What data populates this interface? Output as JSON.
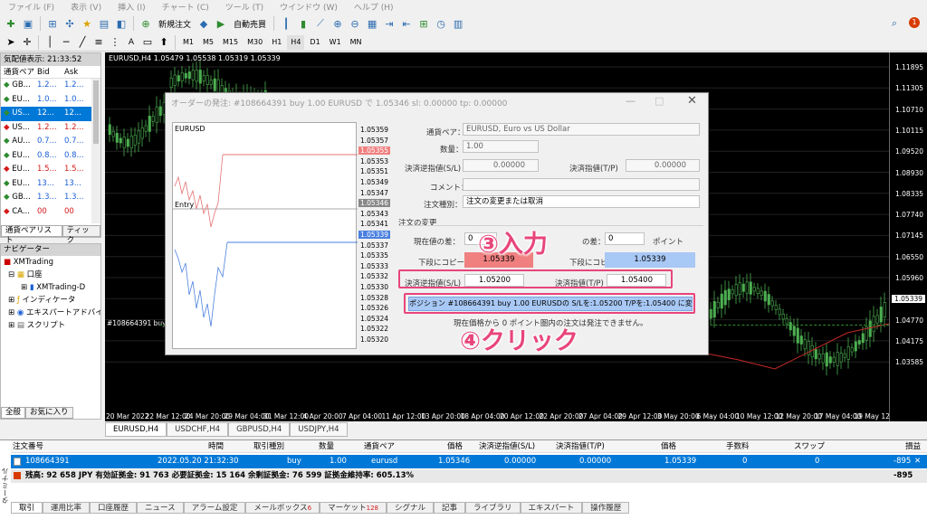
{
  "menu": [
    "ファイル (F)",
    "表示 (V)",
    "挿入 (I)",
    "チャート (C)",
    "ツール (T)",
    "ウインドウ (W)",
    "ヘルプ (H)"
  ],
  "toolbar": {
    "new_order": "新規注文",
    "auto_trade": "自動売買",
    "notif_count": "1"
  },
  "timeframes": [
    "M1",
    "M5",
    "M15",
    "M30",
    "H1",
    "H4",
    "D1",
    "W1",
    "MN"
  ],
  "market": {
    "title": "気配値表示: 21:33:52",
    "cols": [
      "通貨ペア",
      "Bid",
      "Ask"
    ],
    "rows": [
      {
        "s": "GB...",
        "b": "1.2...",
        "a": "1.2...",
        "dir": "up"
      },
      {
        "s": "EU...",
        "b": "1.0...",
        "a": "1.0...",
        "dir": "up"
      },
      {
        "s": "US...",
        "b": "12...",
        "a": "12...",
        "dir": "up",
        "sel": true
      },
      {
        "s": "US...",
        "b": "1.2...",
        "a": "1.2...",
        "dir": "dn"
      },
      {
        "s": "AU...",
        "b": "0.7...",
        "a": "0.7...",
        "dir": "up"
      },
      {
        "s": "EU...",
        "b": "0.8...",
        "a": "0.8...",
        "dir": "up"
      },
      {
        "s": "EU...",
        "b": "1.5...",
        "a": "1.5...",
        "dir": "dn"
      },
      {
        "s": "EU...",
        "b": "13...",
        "a": "13...",
        "dir": "up"
      },
      {
        "s": "GB...",
        "b": "1.3...",
        "a": "1.3...",
        "dir": "up"
      },
      {
        "s": "CA...",
        "b": "00",
        "a": "00",
        "dir": "dn"
      }
    ],
    "tabs": [
      "通貨ペアリスト",
      "ティック"
    ]
  },
  "navigator": {
    "title": "ナビゲーター",
    "items": [
      "XMTrading",
      "口座",
      "XMTrading-D",
      "インディケータ",
      "エキスパートアドバイザ",
      "スクリプト"
    ],
    "tabs": [
      "全般",
      "お気に入り"
    ]
  },
  "chart": {
    "title": "EURUSD,H4  1.05479 1.05538 1.05319 1.05339",
    "order_line": "#108664391 buy 1.00",
    "prices": [
      "1.11895",
      "1.11305",
      "1.10710",
      "1.10115",
      "1.09520",
      "1.08930",
      "1.08335",
      "1.07740",
      "1.07145",
      "1.06550",
      "1.05960",
      "1.05339",
      "1.04770",
      "1.04175",
      "1.03585"
    ],
    "times": [
      "20 Mar 2022",
      "22 Mar 12:00",
      "24 Mar 20:00",
      "29 Mar 04:00",
      "31 Mar 12:00",
      "4 Apr 20:00",
      "7 Apr 04:00",
      "11 Apr 12:00",
      "13 Apr 20:00",
      "18 Apr 04:00",
      "20 Apr 12:00",
      "22 Apr 20:00",
      "27 Apr 04:00",
      "29 Apr 12:00",
      "3 May 20:00",
      "6 May 04:00",
      "10 May 12:00",
      "12 May 20:00",
      "17 May 04:00",
      "19 May 12:00"
    ],
    "tabs": [
      "EURUSD,H4",
      "USDCHF,H4",
      "GBPUSD,H4",
      "USDJPY,H4"
    ]
  },
  "dialog": {
    "title": "オーダーの発注: #108664391 buy 1.00 EURUSD で 1.05346 sl: 0.00000 tp: 0.00000",
    "mini_symbol": "EURUSD",
    "entry": "Entry",
    "mini_prices": [
      "1.05359",
      "1.05357",
      "1.05355",
      "1.05353",
      "1.05351",
      "1.05349",
      "1.05347",
      "1.05346",
      "1.05343",
      "1.05341",
      "1.05339",
      "1.05337",
      "1.05335",
      "1.05333",
      "1.05332",
      "1.05330",
      "1.05328",
      "1.05326",
      "1.05324",
      "1.05322",
      "1.05320"
    ],
    "symbol_label": "通貨ペア：",
    "symbol_value": "EURUSD, Euro vs US Dollar",
    "volume_label": "数量：",
    "volume_value": "1.00",
    "sl_label": "決済逆指値(S/L)",
    "sl_value": "0.00000",
    "tp_label": "決済指値(T/P)",
    "tp_value": "0.00000",
    "comment_label": "コメント：",
    "type_label": "注文種別：",
    "type_value": "注文の変更または取消",
    "modify_header": "注文の変更",
    "diff_label": "現在値の差：",
    "diff_value": "0",
    "diff_label2": "の差：",
    "diff_value2": "0",
    "point": "ポイント",
    "copy_sl_label": "下段にコピー：",
    "copy_sl_value": "1.05339",
    "copy_tp_label": "下段にコピー：",
    "copy_tp_value": "1.05339",
    "new_sl_label": "決済逆指値(S/L)",
    "new_sl_value": "1.05200",
    "new_tp_label": "決済指値(T/P)",
    "new_tp_value": "1.05400",
    "modify_button": "ポジション #108664391 buy 1.00 EURUSDの S/Lを:1.05200 T/Pを:1.05400 に変更する",
    "note": "現在価格から 0 ポイント圏内の注文は発注できません。"
  },
  "callouts": {
    "input": "③入力",
    "click": "④クリック"
  },
  "terminal": {
    "headers": [
      "注文番号",
      "時間",
      "取引種別",
      "数量",
      "通貨ペア",
      "価格",
      "決済逆指値(S/L)",
      "決済指値(T/P)",
      "価格",
      "手数料",
      "スワップ",
      "損益"
    ],
    "order": {
      "ticket": "108664391",
      "time": "2022.05.20 21:32:30",
      "type": "buy",
      "volume": "1.00",
      "symbol": "eurusd",
      "price": "1.05346",
      "sl": "0.00000",
      "tp": "0.00000",
      "cur": "1.05339",
      "commission": "0",
      "swap": "0",
      "profit": "-895"
    },
    "summary": "残高: 92 658 JPY  有効証拠金: 91 763  必要証拠金: 15 164  余剰証拠金: 76 599  証拠金維持率: 605.13%",
    "summary_profit": "-895",
    "tabs": [
      "取引",
      "運用比率",
      "口座履歴",
      "ニュース",
      "アラーム設定",
      "メールボックス",
      "マーケット",
      "シグナル",
      "記事",
      "ライブラリ",
      "エキスパート",
      "操作履歴"
    ],
    "mail_count": "6",
    "market_count": "128",
    "side_label": "ターミナル"
  }
}
